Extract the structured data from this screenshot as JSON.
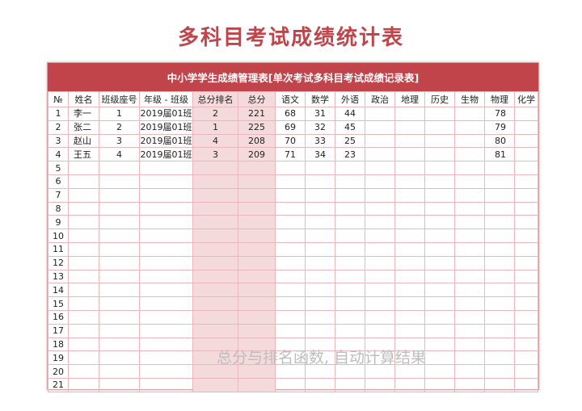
{
  "title": "多科目考试成绩统计表",
  "subtitle": "中小学学生成绩管理表[单次考试多科目考试成绩记录表]",
  "headers": [
    "№",
    "姓名",
    "班级座号",
    "年级 - 班级",
    "总分排名",
    "总分",
    "语文",
    "数学",
    "外语",
    "政治",
    "地理",
    "历史",
    "生物",
    "物理",
    "化学"
  ],
  "rows": [
    [
      "1",
      "李一",
      "1",
      "2019届01班",
      "2",
      "221",
      "68",
      "31",
      "44",
      "",
      "",
      "",
      "",
      "78",
      ""
    ],
    [
      "2",
      "张二",
      "2",
      "2019届01班",
      "1",
      "225",
      "69",
      "32",
      "45",
      "",
      "",
      "",
      "",
      "79",
      ""
    ],
    [
      "3",
      "赵山",
      "3",
      "2019届01班",
      "4",
      "208",
      "70",
      "33",
      "25",
      "",
      "",
      "",
      "",
      "80",
      ""
    ],
    [
      "4",
      "王五",
      "4",
      "2019届01班",
      "3",
      "209",
      "71",
      "34",
      "23",
      "",
      "",
      "",
      "",
      "81",
      ""
    ],
    [
      "5",
      "",
      "",
      "",
      "",
      "",
      "",
      "",
      "",
      "",
      "",
      "",
      "",
      "",
      ""
    ],
    [
      "6",
      "",
      "",
      "",
      "",
      "",
      "",
      "",
      "",
      "",
      "",
      "",
      "",
      "",
      ""
    ],
    [
      "7",
      "",
      "",
      "",
      "",
      "",
      "",
      "",
      "",
      "",
      "",
      "",
      "",
      "",
      ""
    ],
    [
      "8",
      "",
      "",
      "",
      "",
      "",
      "",
      "",
      "",
      "",
      "",
      "",
      "",
      "",
      ""
    ],
    [
      "9",
      "",
      "",
      "",
      "",
      "",
      "",
      "",
      "",
      "",
      "",
      "",
      "",
      "",
      ""
    ],
    [
      "10",
      "",
      "",
      "",
      "",
      "",
      "",
      "",
      "",
      "",
      "",
      "",
      "",
      "",
      ""
    ],
    [
      "11",
      "",
      "",
      "",
      "",
      "",
      "",
      "",
      "",
      "",
      "",
      "",
      "",
      "",
      ""
    ],
    [
      "12",
      "",
      "",
      "",
      "",
      "",
      "",
      "",
      "",
      "",
      "",
      "",
      "",
      "",
      ""
    ],
    [
      "13",
      "",
      "",
      "",
      "",
      "",
      "",
      "",
      "",
      "",
      "",
      "",
      "",
      "",
      ""
    ],
    [
      "14",
      "",
      "",
      "",
      "",
      "",
      "",
      "",
      "",
      "",
      "",
      "",
      "",
      "",
      ""
    ],
    [
      "15",
      "",
      "",
      "",
      "",
      "",
      "",
      "",
      "",
      "",
      "",
      "",
      "",
      "",
      ""
    ],
    [
      "16",
      "",
      "",
      "",
      "",
      "",
      "",
      "",
      "",
      "",
      "",
      "",
      "",
      "",
      ""
    ],
    [
      "17",
      "",
      "",
      "",
      "",
      "",
      "",
      "",
      "",
      "",
      "",
      "",
      "",
      "",
      ""
    ],
    [
      "18",
      "",
      "",
      "",
      "",
      "",
      "",
      "",
      "",
      "",
      "",
      "",
      "",
      "",
      ""
    ],
    [
      "19",
      "",
      "",
      "",
      "",
      "",
      "",
      "",
      "",
      "",
      "",
      "",
      "",
      "",
      ""
    ],
    [
      "20",
      "",
      "",
      "",
      "",
      "",
      "",
      "",
      "",
      "",
      "",
      "",
      "",
      "",
      ""
    ],
    [
      "21",
      "",
      "",
      "",
      "",
      "",
      "",
      "",
      "",
      "",
      "",
      "",
      "",
      "",
      ""
    ]
  ],
  "watermark": "总分与排名函数, 自动计算结果",
  "colors": {
    "accent": "#c0444a",
    "highlight": "#f5dadb",
    "grid": "#e8b8ba"
  }
}
